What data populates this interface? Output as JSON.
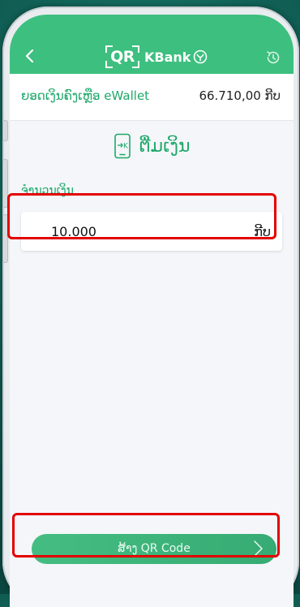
{
  "header": {
    "logo_qr": "QR",
    "logo_brand": "KBank",
    "back_icon": "chevron-left-icon",
    "history_icon": "history-clock-icon"
  },
  "balance": {
    "label": "ຍອດເງິນຄົງເຫຼືອ eWallet",
    "amount": "66.710,00 ກີບ"
  },
  "topup": {
    "title": "ຕື່ມເງິນ",
    "icon": "phone-topup-icon"
  },
  "amount": {
    "label": "ຈຳນວນເງິນ",
    "value": "10.000",
    "unit": "ກີບ"
  },
  "generate_button": {
    "label": "ສ້າງ QR Code",
    "icon": "chevron-right-icon"
  },
  "colors": {
    "brand_green": "#3dbf7f",
    "text_green": "#1ea869",
    "highlight_red": "#e30000"
  }
}
